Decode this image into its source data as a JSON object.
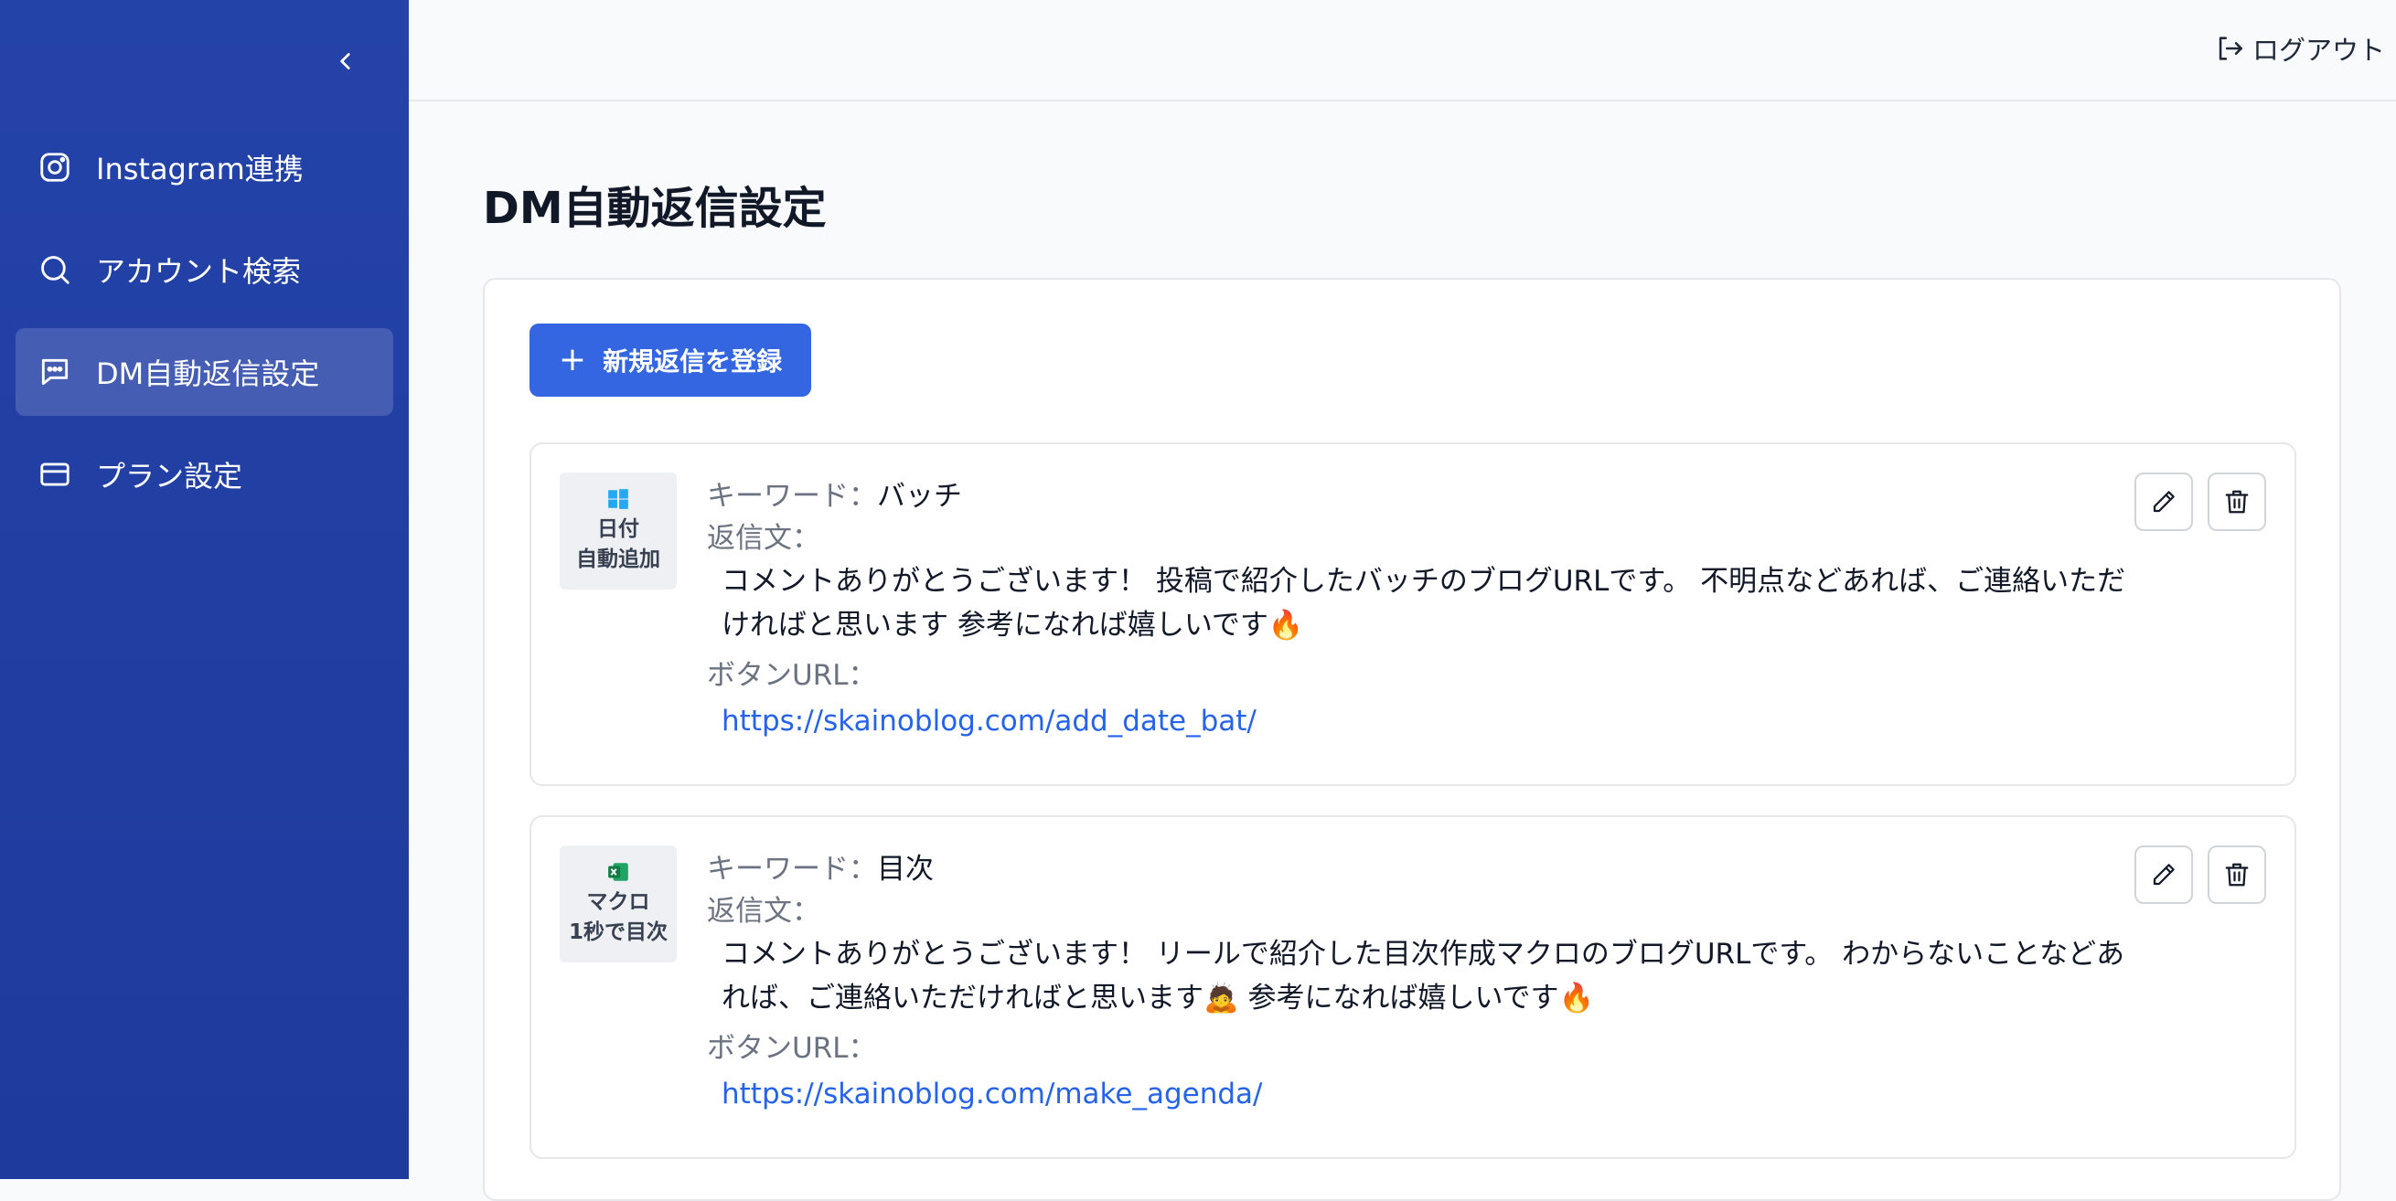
{
  "sidebar": {
    "items": [
      {
        "label": "Instagram連携",
        "icon": "instagram-icon"
      },
      {
        "label": "アカウント検索",
        "icon": "search-icon"
      },
      {
        "label": "DM自動返信設定",
        "icon": "message-icon",
        "active": true
      },
      {
        "label": "プラン設定",
        "icon": "credit-card-icon"
      }
    ]
  },
  "header": {
    "logout_label": "ログアウト"
  },
  "page": {
    "title": "DM自動返信設定",
    "add_button_label": "新規返信を登録"
  },
  "labels": {
    "keyword": "キーワード：",
    "reply": "返信文：",
    "button_url": "ボタンURL："
  },
  "replies": [
    {
      "thumb_line1": "日付",
      "thumb_line2": "自動追加",
      "keyword": "バッチ",
      "reply_text": "コメントありがとうございます！ 投稿で紹介したバッチのブログURLです。 不明点などあれば、ご連絡いただければと思います 参考になれば嬉しいです🔥",
      "url": "https://skainoblog.com/add_date_bat/"
    },
    {
      "thumb_line1": "マクロ",
      "thumb_line2": "1秒で目次",
      "keyword": "目次",
      "reply_text": "コメントありがとうございます！ リールで紹介した目次作成マクロのブログURLです。 わからないことなどあれば、ご連絡いただければと思います🙇 参考になれば嬉しいです🔥",
      "url": "https://skainoblog.com/make_agenda/"
    }
  ],
  "colors": {
    "sidebar": "#2443a9",
    "primary_button": "#3366e0",
    "link": "#2563eb"
  }
}
